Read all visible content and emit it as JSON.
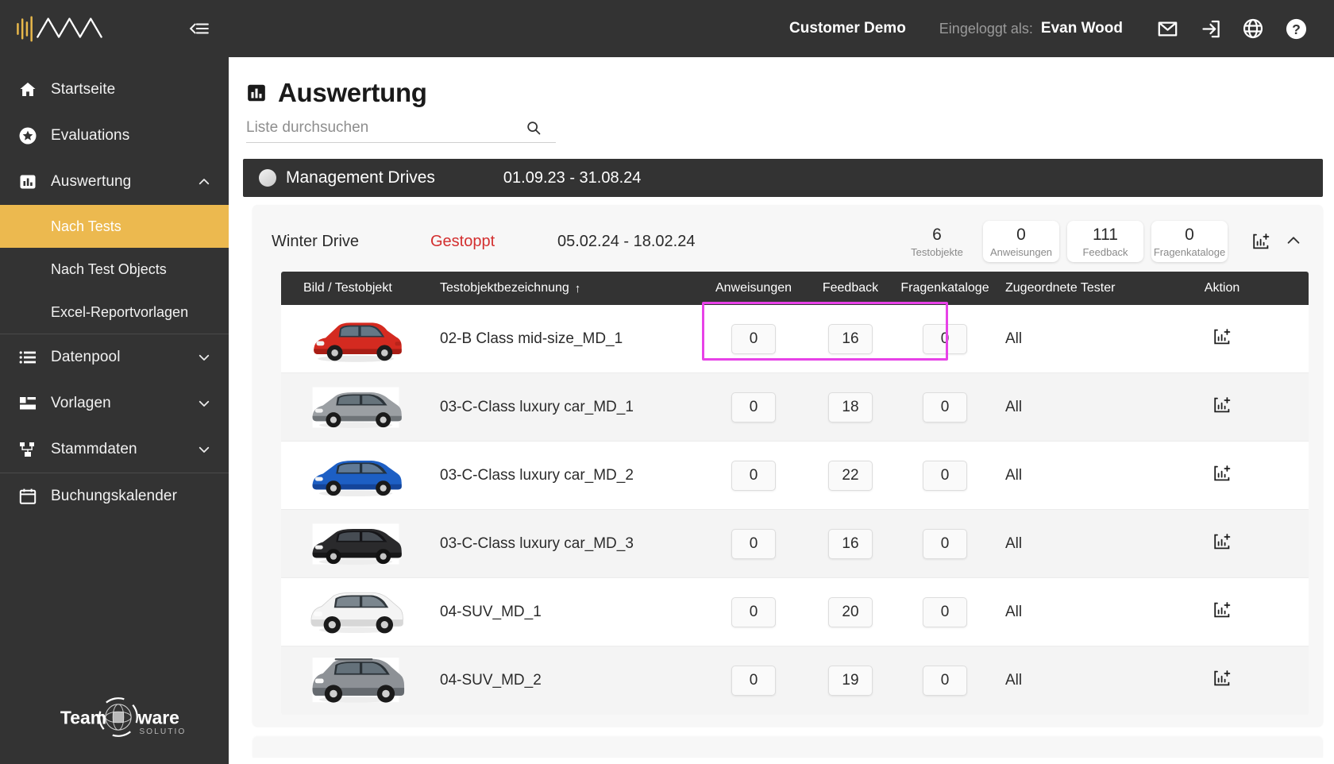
{
  "sidebar": {
    "brand_logo": "waveform-mountain-logo",
    "collapse_icon": "collapse-sidebar-icon",
    "items": [
      {
        "label": "Startseite",
        "icon": "home-icon",
        "expandable": false
      },
      {
        "label": "Evaluations",
        "icon": "star-circle-icon",
        "expandable": false
      },
      {
        "label": "Auswertung",
        "icon": "bar-chart-icon",
        "expandable": true,
        "expanded": true
      }
    ],
    "subitems": [
      {
        "label": "Nach Tests",
        "active": true
      },
      {
        "label": "Nach Test Objects",
        "active": false
      },
      {
        "label": "Excel-Reportvorlagen",
        "active": false
      }
    ],
    "items2": [
      {
        "label": "Datenpool",
        "icon": "list-icon",
        "expandable": true
      },
      {
        "label": "Vorlagen",
        "icon": "layout-icon",
        "expandable": true
      },
      {
        "label": "Stammdaten",
        "icon": "hierarchy-icon",
        "expandable": true
      },
      {
        "label": "Buchungskalender",
        "icon": "calendar-icon",
        "expandable": false
      }
    ],
    "footer_logo_line1": "Team",
    "footer_logo_line2": "ware",
    "footer_logo_sub": "SOLUTIONS"
  },
  "topbar": {
    "customer": "Customer Demo",
    "logged_label": "Eingeloggt als:",
    "user": "Evan Wood",
    "icons": [
      "mail-icon",
      "logout-icon",
      "globe-icon",
      "help-icon"
    ]
  },
  "page": {
    "title": "Auswertung",
    "title_icon": "bar-chart-icon"
  },
  "search": {
    "placeholder": "Liste durchsuchen",
    "value": "",
    "icon": "search-icon"
  },
  "group": {
    "name": "Management Drives",
    "dates": "01.09.23 - 31.08.24"
  },
  "drive": {
    "name": "Winter Drive",
    "status": "Gestoppt",
    "status_color": "#d32f2f",
    "dates": "05.02.24 - 18.02.24",
    "stats": [
      {
        "value": "6",
        "label": "Testobjekte",
        "boxed": false
      },
      {
        "value": "0",
        "label": "Anweisungen",
        "boxed": true
      },
      {
        "value": "111",
        "label": "Feedback",
        "boxed": true
      },
      {
        "value": "0",
        "label": "Fragenkataloge",
        "boxed": true
      }
    ],
    "report_icon": "add-report-icon",
    "collapse_icon": "chevron-up-icon"
  },
  "table": {
    "columns": [
      "Bild / Testobjekt",
      "Testobjektbezeichnung",
      "Anweisungen",
      "Feedback",
      "Fragenkataloge",
      "Zugeordnete Tester",
      "Aktion"
    ],
    "sort_column": "Testobjektbezeichnung",
    "sort_arrow": "↑",
    "rows": [
      {
        "image": "red-hatchback-car",
        "name": "02-B Class mid-size_MD_1",
        "anweisungen": "0",
        "feedback": "16",
        "fragenkataloge": "0",
        "tester": "All",
        "action_icon": "add-report-icon",
        "highlighted": true
      },
      {
        "image": "grey-sedan-car",
        "name": "03-C-Class luxury car_MD_1",
        "anweisungen": "0",
        "feedback": "18",
        "fragenkataloge": "0",
        "tester": "All",
        "action_icon": "add-report-icon",
        "highlighted": false
      },
      {
        "image": "blue-sedan-car",
        "name": "03-C-Class luxury car_MD_2",
        "anweisungen": "0",
        "feedback": "22",
        "fragenkataloge": "0",
        "tester": "All",
        "action_icon": "add-report-icon",
        "highlighted": false
      },
      {
        "image": "black-sedan-car",
        "name": "03-C-Class luxury car_MD_3",
        "anweisungen": "0",
        "feedback": "16",
        "fragenkataloge": "0",
        "tester": "All",
        "action_icon": "add-report-icon",
        "highlighted": false
      },
      {
        "image": "white-suv-car",
        "name": "04-SUV_MD_1",
        "anweisungen": "0",
        "feedback": "20",
        "fragenkataloge": "0",
        "tester": "All",
        "action_icon": "add-report-icon",
        "highlighted": false
      },
      {
        "image": "grey-suv-car",
        "name": "04-SUV_MD_2",
        "anweisungen": "0",
        "feedback": "19",
        "fragenkataloge": "0",
        "tester": "All",
        "action_icon": "add-report-icon",
        "highlighted": false
      }
    ]
  },
  "colors": {
    "sidebar_bg": "#333333",
    "accent": "#ecb94f",
    "status_stopped": "#d32f2f",
    "highlight": "#e742e7",
    "card_bg": "#f7f7f7"
  }
}
